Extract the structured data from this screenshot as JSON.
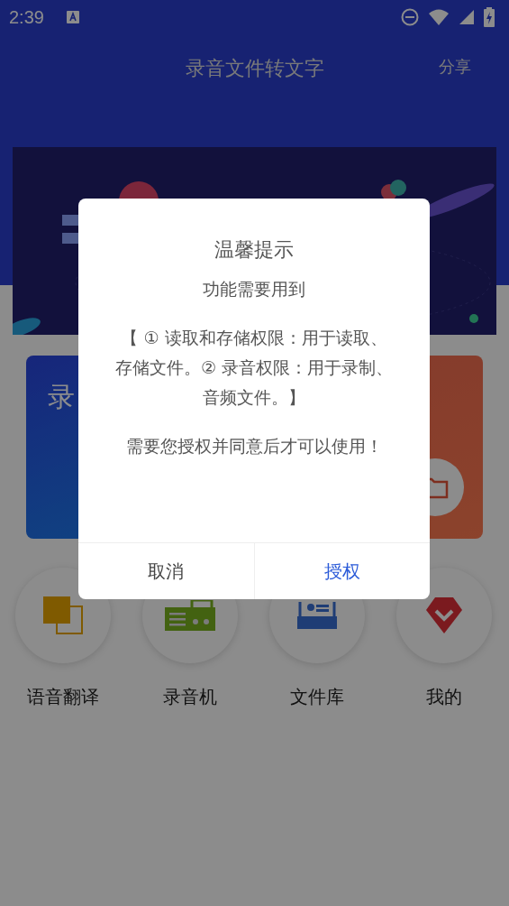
{
  "status_bar": {
    "time": "2:39"
  },
  "header": {
    "title": "录音文件转文字",
    "action": "分享"
  },
  "cards": [
    {
      "title": "录",
      "kind": "record"
    },
    {
      "kind": "folder"
    }
  ],
  "shortcuts": [
    {
      "label": "语音翻译",
      "kind": "translate"
    },
    {
      "label": "录音机",
      "kind": "recorder"
    },
    {
      "label": "文件库",
      "kind": "library"
    },
    {
      "label": "我的",
      "kind": "profile"
    }
  ],
  "dialog": {
    "title": "温馨提示",
    "paragraphs": [
      "功能需要用到",
      "【 ① 读取和存储权限：用于读取、存储文件。② 录音权限：用于录制、音频文件。】",
      "需要您授权并同意后才可以使用！"
    ],
    "buttons": [
      {
        "label": "取消",
        "kind": "cancel"
      },
      {
        "label": "授权",
        "kind": "primary"
      }
    ]
  }
}
